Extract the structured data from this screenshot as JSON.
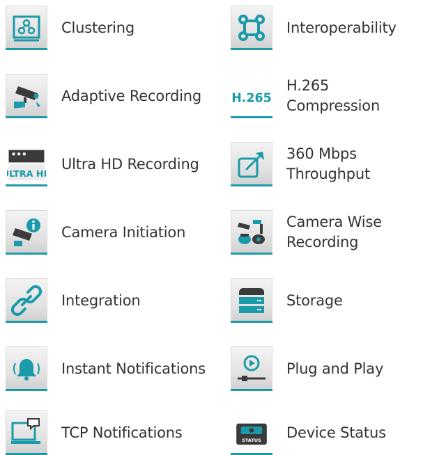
{
  "accent_color": "#1b9aa9",
  "features": [
    {
      "label": "Clustering",
      "icon": "clustering-icon"
    },
    {
      "label": "Interoperability",
      "icon": "interoperability-icon"
    },
    {
      "label": "Adaptive Recording",
      "icon": "cctv-camera-icon"
    },
    {
      "label": "H.265 Compression",
      "icon": "h265-icon",
      "icon_text": "H.265"
    },
    {
      "label": "Ultra HD Recording",
      "icon": "ultra-hd-icon",
      "icon_text": "ULTRA HD"
    },
    {
      "label": "360 Mbps\nThroughput",
      "icon": "throughput-arrow-icon"
    },
    {
      "label": "Camera Initiation",
      "icon": "camera-info-icon"
    },
    {
      "label": "Camera Wise\nRecording",
      "icon": "multi-camera-icon"
    },
    {
      "label": "Integration",
      "icon": "link-icon"
    },
    {
      "label": "Storage",
      "icon": "storage-icon"
    },
    {
      "label": "Instant Notifications",
      "icon": "bell-icon"
    },
    {
      "label": "Plug and Play",
      "icon": "plug-and-play-icon"
    },
    {
      "label": "TCP Notifications",
      "icon": "computer-message-icon"
    },
    {
      "label": "Device Status",
      "icon": "device-status-icon",
      "icon_text": "STATUS"
    }
  ]
}
